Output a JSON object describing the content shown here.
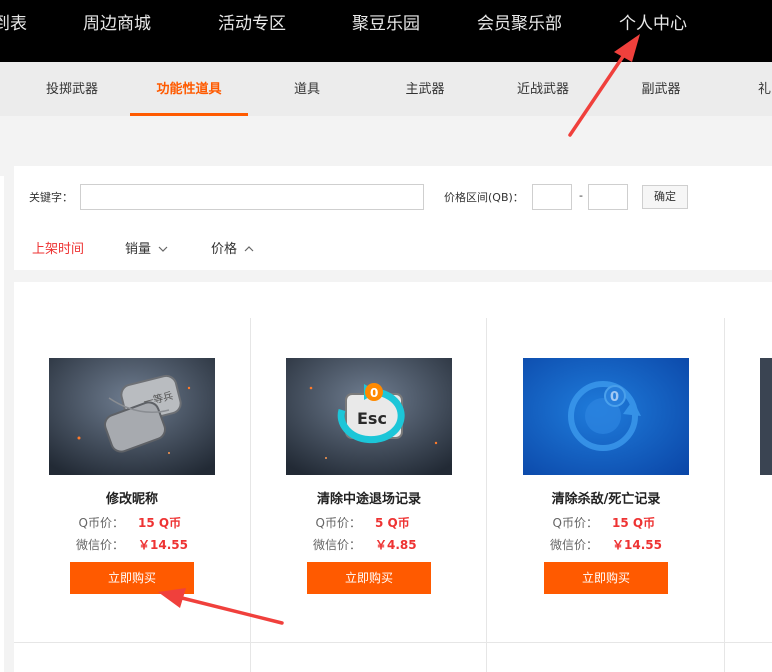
{
  "top_nav": {
    "items": [
      "到表",
      "周边商城",
      "活动专区",
      "聚豆乐园",
      "会员聚乐部",
      "个人中心"
    ]
  },
  "category_tabs": {
    "items": [
      "投掷武器",
      "功能性道具",
      "道具",
      "主武器",
      "近战武器",
      "副武器",
      "礼"
    ],
    "active_index": 1
  },
  "filter": {
    "keyword_label": "关键字：",
    "keyword_value": "",
    "price_range_label": "价格区间(QB)：",
    "price_min": "",
    "price_max": "",
    "range_separator": "-",
    "confirm_label": "确定",
    "sorts": [
      {
        "label": "上架时间",
        "active": true
      },
      {
        "label": "销量",
        "indicator": "chevron-down"
      },
      {
        "label": "价格",
        "indicator": "chevron-up"
      }
    ]
  },
  "products": [
    {
      "name": "修改昵称",
      "q_label": "Q币价：",
      "q_price": "15 Q币",
      "wx_label": "微信价：",
      "wx_price": "￥14.55",
      "buy_label": "立即购买",
      "icon": "dog-tag-icon"
    },
    {
      "name": "清除中途退场记录",
      "q_label": "Q币价：",
      "q_price": "5 Q币",
      "wx_label": "微信价：",
      "wx_price": "￥4.85",
      "buy_label": "立即购买",
      "icon": "esc-key-icon"
    },
    {
      "name": "清除杀敌/死亡记录",
      "q_label": "Q币价：",
      "q_price": "15 Q币",
      "wx_label": "微信价：",
      "wx_price": "￥14.55",
      "buy_label": "立即购买",
      "icon": "kd-reset-icon"
    }
  ],
  "colors": {
    "accent": "#ff5a00",
    "price_red": "#e33333",
    "annotation_arrow": "#f0403c"
  }
}
